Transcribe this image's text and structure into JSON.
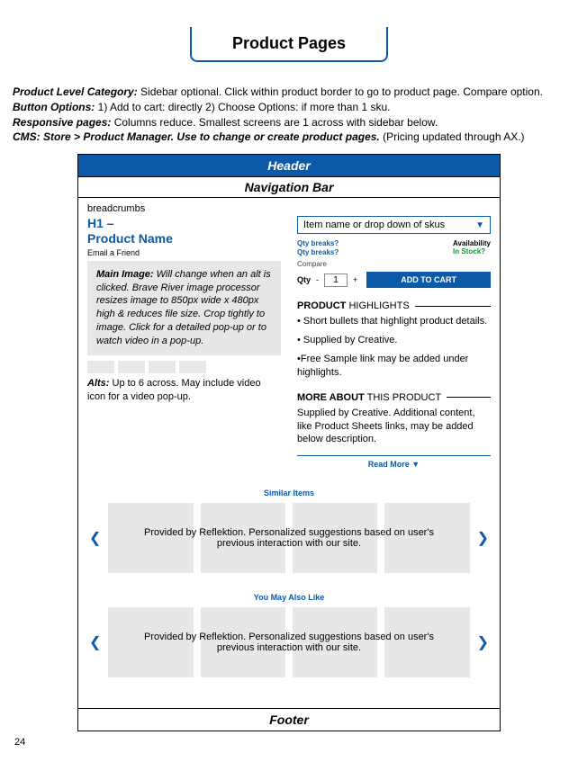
{
  "page_number": "24",
  "title": "Product Pages",
  "intro": {
    "cat_label": "Product Level Category:",
    "cat_text": " Sidebar optional. Click within product border to go to product page. Compare option.",
    "btn_label": "Button Options:",
    "btn_text": " 1) Add to cart: directly 2) Choose Options: if more than 1 sku.",
    "resp_label": "Responsive pages:",
    "resp_text": " Columns reduce. Smallest screens are 1 across with sidebar below.",
    "cms_label": "CMS: Store > Product Manager. Use to change or create product pages.",
    "cms_text": " (Pricing updated through AX.)"
  },
  "mock": {
    "header": "Header",
    "nav": "Navigation Bar",
    "breadcrumbs": "breadcrumbs",
    "h1_line1": "H1 –",
    "h1_line2": "Product Name",
    "email_friend": "Email a Friend",
    "main_image_label": "Main Image:",
    "main_image_text": " Will change when an alt is clicked. Brave River image processor resizes image to 850px wide x 480px high & reduces file size. Crop tightly to image. Click for a detailed pop-up or to watch video in a pop-up.",
    "alts_label": "Alts:",
    "alts_text": " Up to 6 across. May include video icon for a video pop-up.",
    "sku_dropdown": "Item name or drop down of skus",
    "qty_breaks": "Qty breaks?",
    "availability_label": "Availability",
    "instock": "In Stock?",
    "compare": "Compare",
    "qty_label": "Qty",
    "qty_value": "1",
    "minus": "-",
    "plus": "+",
    "add_to_cart": "ADD TO CART",
    "highlights_bold": "PRODUCT",
    "highlights_rest": " HIGHLIGHTS",
    "highlight_b1": "• Short bullets that highlight product details.",
    "highlight_b2": "• Supplied by Creative.",
    "highlight_b3": "•Free Sample link may be added under highlights.",
    "more_bold": "MORE ABOUT",
    "more_rest": " THIS PRODUCT",
    "more_text": "Supplied by Creative. Additional content, like Product Sheets links, may be added below description.",
    "read_more": "Read More  ▼",
    "similar": "Similar Items",
    "youmay": "You May Also Like",
    "carousel_text": "Provided by Reflektion. Personalized suggestions based on user's previous interaction with our site.",
    "footer": "Footer"
  }
}
